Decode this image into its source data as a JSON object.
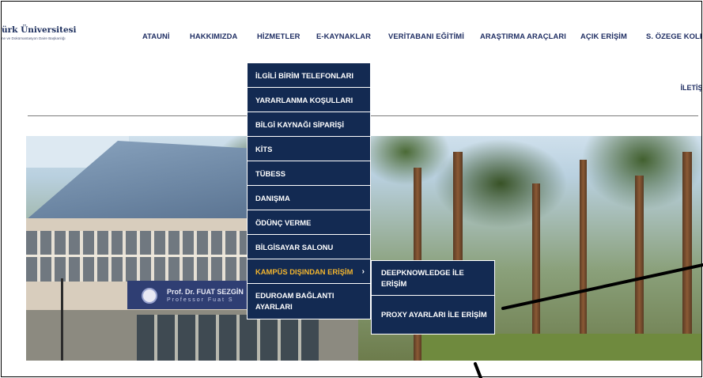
{
  "brand": {
    "title": "ürk Üniversitesi",
    "subtitle": "ne ve Dokümantasyon Daire Başkanlığı"
  },
  "nav": {
    "items": [
      {
        "label": "ATAUNİ"
      },
      {
        "label": "HAKKIMIZDA"
      },
      {
        "label": "HİZMETLER"
      },
      {
        "label": "E-KAYNAKLAR"
      },
      {
        "label": "VERİTABANI EĞİTİMİ"
      },
      {
        "label": "ARAŞTIRMA ARAÇLARI"
      },
      {
        "label": "AÇIK ERİŞİM"
      },
      {
        "label": "S. ÖZEGE KOLEKS"
      }
    ],
    "contact": "İLETİŞİ"
  },
  "services_menu": {
    "items": [
      {
        "label": "İLGİLİ BİRİM TELEFONLARI"
      },
      {
        "label": "YARARLANMA KOŞULLARI"
      },
      {
        "label": "BİLGİ KAYNAĞI SİPARİŞİ"
      },
      {
        "label": "KİTS"
      },
      {
        "label": "TÜBESS"
      },
      {
        "label": "DANIŞMA"
      },
      {
        "label": "ÖDÜNÇ VERME"
      },
      {
        "label": "BİLGİSAYAR SALONU"
      },
      {
        "label": "KAMPÜS DIŞINDAN ERİŞİM"
      },
      {
        "label": "EDUROAM BAĞLANTI AYARLARI"
      }
    ],
    "chevron": "›"
  },
  "offcampus_submenu": {
    "items": [
      {
        "label": "DEEPKNOWLEDGE İLE ERİŞİM"
      },
      {
        "label": "PROXY AYARLARI İLE ERİŞİM"
      }
    ]
  },
  "hero": {
    "sign_title": "Prof. Dr. FUAT SEZGİN",
    "sign_subtitle": "Professor Fuat S"
  },
  "colors": {
    "menu_bg": "#132a52",
    "nav_text": "#1f2e63",
    "active_item": "#f3b52e"
  }
}
